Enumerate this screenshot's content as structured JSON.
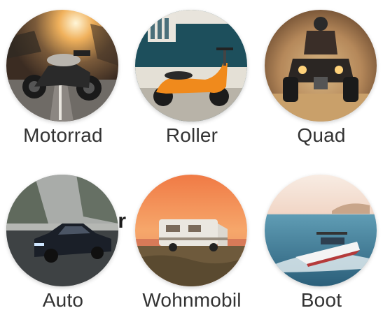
{
  "hidden_heading": "hr",
  "vehicles": [
    {
      "label": "Motorrad",
      "icon": "motorcycle-photo"
    },
    {
      "label": "Roller",
      "icon": "scooter-photo"
    },
    {
      "label": "Quad",
      "icon": "quad-photo"
    },
    {
      "label": "Auto",
      "icon": "car-photo"
    },
    {
      "label": "Wohnmobil",
      "icon": "camper-photo"
    },
    {
      "label": "Boot",
      "icon": "boat-photo"
    }
  ],
  "colors": {
    "label_text": "#333333",
    "background": "#ffffff"
  }
}
